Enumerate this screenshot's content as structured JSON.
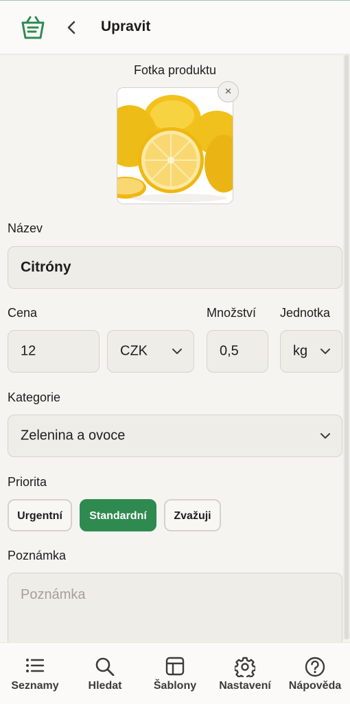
{
  "header": {
    "title": "Upravit"
  },
  "photo": {
    "label": "Fotka produktu",
    "remove_symbol": "×",
    "icon": "lemon-photo"
  },
  "form": {
    "name": {
      "label": "Název",
      "value": "Citróny"
    },
    "price": {
      "label": "Cena",
      "value": "12"
    },
    "currency": {
      "value": "CZK"
    },
    "quantity": {
      "label": "Množství",
      "value": "0,5"
    },
    "unit": {
      "label": "Jednotka",
      "value": "kg"
    },
    "category": {
      "label": "Kategorie",
      "value": "Zelenina a ovoce"
    },
    "priority": {
      "label": "Priorita",
      "options": [
        "Urgentní",
        "Standardní",
        "Zvažuji"
      ],
      "selected": "Standardní"
    },
    "note": {
      "label": "Poznámka",
      "placeholder": "Poznámka"
    }
  },
  "nav": {
    "items": [
      {
        "label": "Seznamy",
        "icon": "list-icon"
      },
      {
        "label": "Hledat",
        "icon": "search-icon"
      },
      {
        "label": "Šablony",
        "icon": "template-icon"
      },
      {
        "label": "Nastavení",
        "icon": "gear-icon"
      },
      {
        "label": "Nápověda",
        "icon": "help-icon"
      }
    ]
  },
  "colors": {
    "accent": "#2e8a4f",
    "background": "#f5f4f0",
    "field": "#efede8"
  }
}
